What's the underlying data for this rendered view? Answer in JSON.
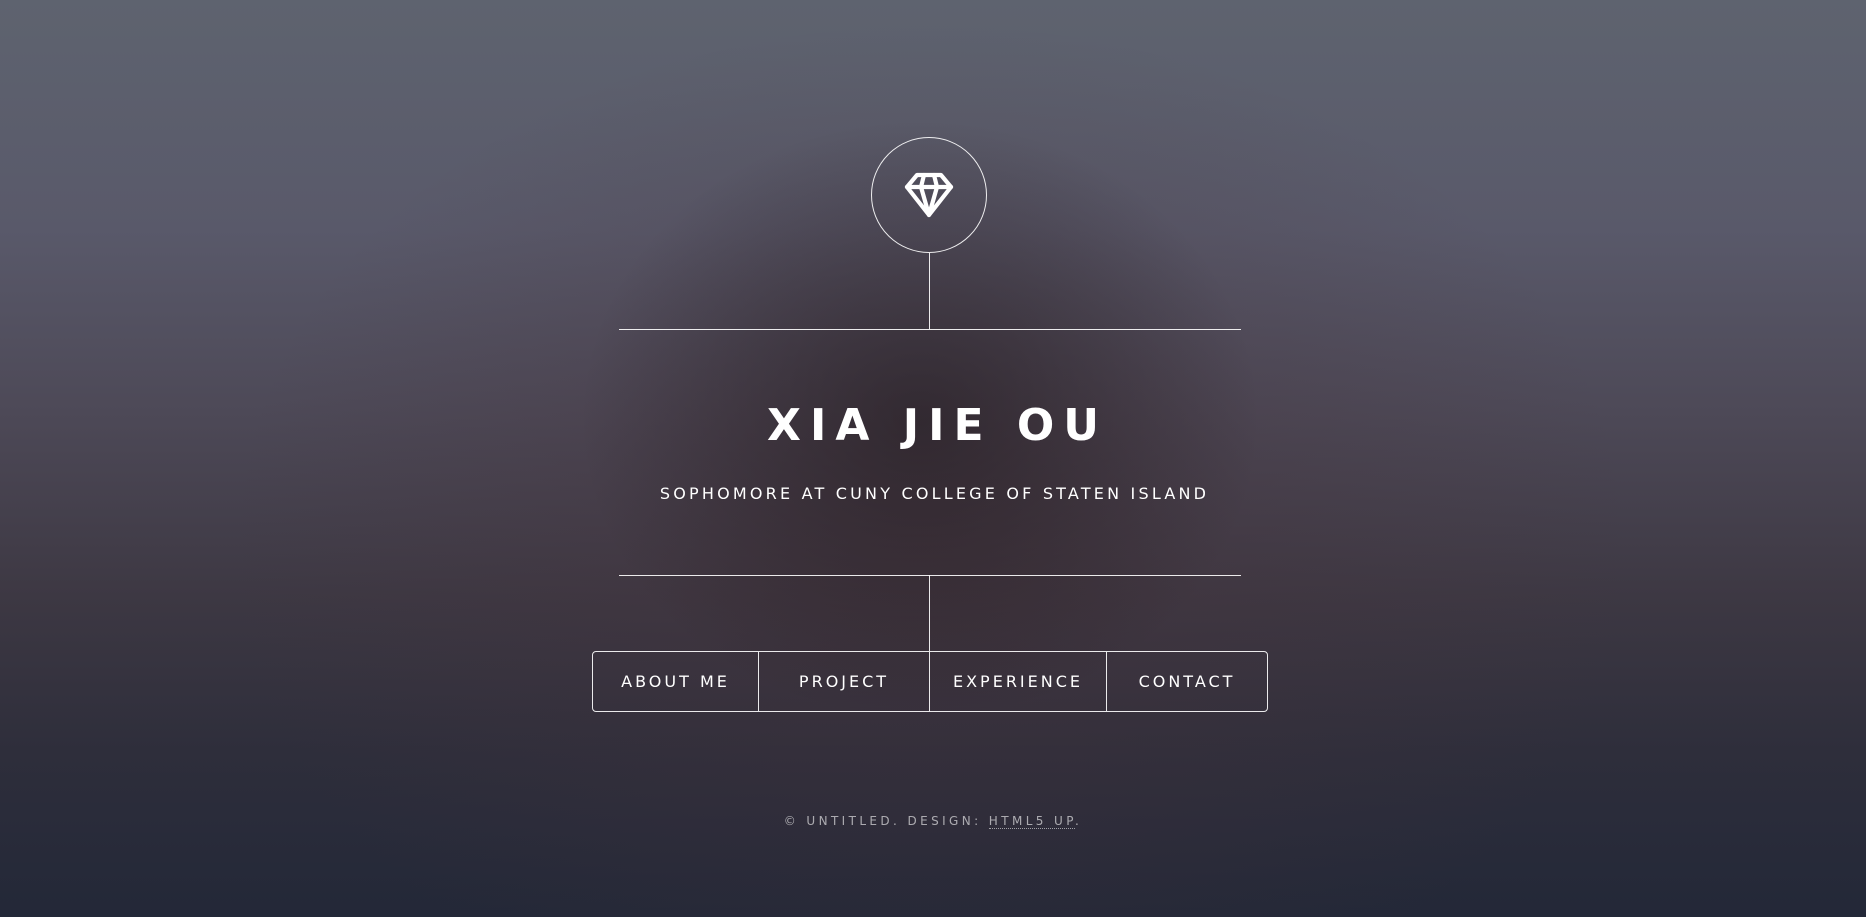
{
  "header": {
    "logo_icon": "diamond-icon",
    "title": "XIA JIE OU",
    "subtitle": "SOPHOMORE AT CUNY COLLEGE OF STATEN ISLAND"
  },
  "nav": {
    "items": [
      {
        "label": "ABOUT ME"
      },
      {
        "label": "PROJECT"
      },
      {
        "label": "EXPERIENCE"
      },
      {
        "label": "CONTACT"
      }
    ]
  },
  "footer": {
    "copyright": "© UNTITLED. DESIGN: ",
    "credit_link": "HTML5 UP",
    "trailing": "."
  }
}
